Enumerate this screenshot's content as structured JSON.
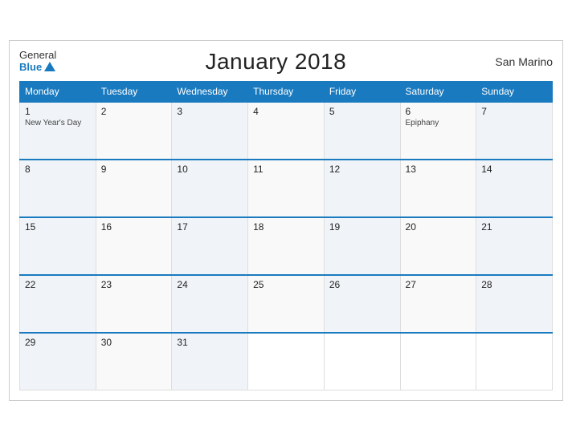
{
  "header": {
    "title": "January 2018",
    "country": "San Marino",
    "logo_general": "General",
    "logo_blue": "Blue"
  },
  "days_of_week": [
    "Monday",
    "Tuesday",
    "Wednesday",
    "Thursday",
    "Friday",
    "Saturday",
    "Sunday"
  ],
  "weeks": [
    [
      {
        "date": "1",
        "event": "New Year's Day"
      },
      {
        "date": "2",
        "event": ""
      },
      {
        "date": "3",
        "event": ""
      },
      {
        "date": "4",
        "event": ""
      },
      {
        "date": "5",
        "event": ""
      },
      {
        "date": "6",
        "event": "Epiphany"
      },
      {
        "date": "7",
        "event": ""
      }
    ],
    [
      {
        "date": "8",
        "event": ""
      },
      {
        "date": "9",
        "event": ""
      },
      {
        "date": "10",
        "event": ""
      },
      {
        "date": "11",
        "event": ""
      },
      {
        "date": "12",
        "event": ""
      },
      {
        "date": "13",
        "event": ""
      },
      {
        "date": "14",
        "event": ""
      }
    ],
    [
      {
        "date": "15",
        "event": ""
      },
      {
        "date": "16",
        "event": ""
      },
      {
        "date": "17",
        "event": ""
      },
      {
        "date": "18",
        "event": ""
      },
      {
        "date": "19",
        "event": ""
      },
      {
        "date": "20",
        "event": ""
      },
      {
        "date": "21",
        "event": ""
      }
    ],
    [
      {
        "date": "22",
        "event": ""
      },
      {
        "date": "23",
        "event": ""
      },
      {
        "date": "24",
        "event": ""
      },
      {
        "date": "25",
        "event": ""
      },
      {
        "date": "26",
        "event": ""
      },
      {
        "date": "27",
        "event": ""
      },
      {
        "date": "28",
        "event": ""
      }
    ],
    [
      {
        "date": "29",
        "event": ""
      },
      {
        "date": "30",
        "event": ""
      },
      {
        "date": "31",
        "event": ""
      },
      null,
      null,
      null,
      null
    ]
  ]
}
